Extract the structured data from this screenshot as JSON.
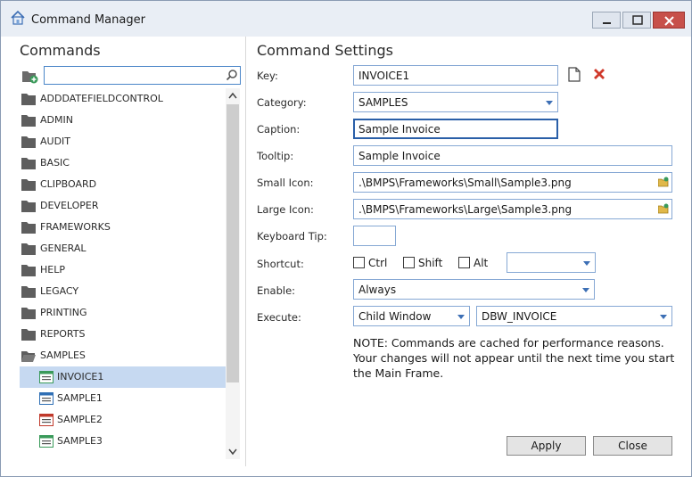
{
  "window": {
    "title": "Command Manager",
    "accent": "#3d6fb5",
    "close_color": "#c7504a"
  },
  "left": {
    "title": "Commands",
    "search_value": "",
    "tree": [
      {
        "label": "ADDDATEFIELDCONTROL",
        "type": "folder"
      },
      {
        "label": "ADMIN",
        "type": "folder"
      },
      {
        "label": "AUDIT",
        "type": "folder"
      },
      {
        "label": "BASIC",
        "type": "folder"
      },
      {
        "label": "CLIPBOARD",
        "type": "folder"
      },
      {
        "label": "DEVELOPER",
        "type": "folder"
      },
      {
        "label": "FRAMEWORKS",
        "type": "folder"
      },
      {
        "label": "GENERAL",
        "type": "folder"
      },
      {
        "label": "HELP",
        "type": "folder"
      },
      {
        "label": "LEGACY",
        "type": "folder"
      },
      {
        "label": "PRINTING",
        "type": "folder"
      },
      {
        "label": "REPORTS",
        "type": "folder"
      },
      {
        "label": "SAMPLES",
        "type": "folder-open"
      },
      {
        "label": "INVOICE1",
        "type": "command",
        "selected": true,
        "icon_color": "#3a9a5a"
      },
      {
        "label": "SAMPLE1",
        "type": "command",
        "icon_color": "#2f6fb5"
      },
      {
        "label": "SAMPLE2",
        "type": "command",
        "icon_color": "#c0392b"
      },
      {
        "label": "SAMPLE3",
        "type": "command",
        "icon_color": "#3a9a5a"
      }
    ]
  },
  "right": {
    "title": "Command Settings",
    "labels": {
      "key": "Key:",
      "category": "Category:",
      "caption": "Caption:",
      "tooltip": "Tooltip:",
      "small_icon": "Small Icon:",
      "large_icon": "Large Icon:",
      "keyboard_tip": "Keyboard Tip:",
      "shortcut": "Shortcut:",
      "enable": "Enable:",
      "execute": "Execute:"
    },
    "values": {
      "key": "INVOICE1",
      "category": "SAMPLES",
      "caption": "Sample Invoice",
      "tooltip": "Sample Invoice",
      "small_icon": ".\\BMPS\\Frameworks\\Small\\Sample3.png",
      "large_icon": ".\\BMPS\\Frameworks\\Large\\Sample3.png",
      "keyboard_tip": "",
      "shortcut_key": "",
      "enable": "Always",
      "execute_type": "Child Window",
      "execute_target": "DBW_INVOICE"
    },
    "shortcut_mods": {
      "ctrl": "Ctrl",
      "shift": "Shift",
      "alt": "Alt"
    },
    "note": "NOTE: Commands are cached for performance reasons. Your changes will not appear until the next time you start the Main Frame.",
    "buttons": {
      "apply": "Apply",
      "close": "Close"
    }
  }
}
